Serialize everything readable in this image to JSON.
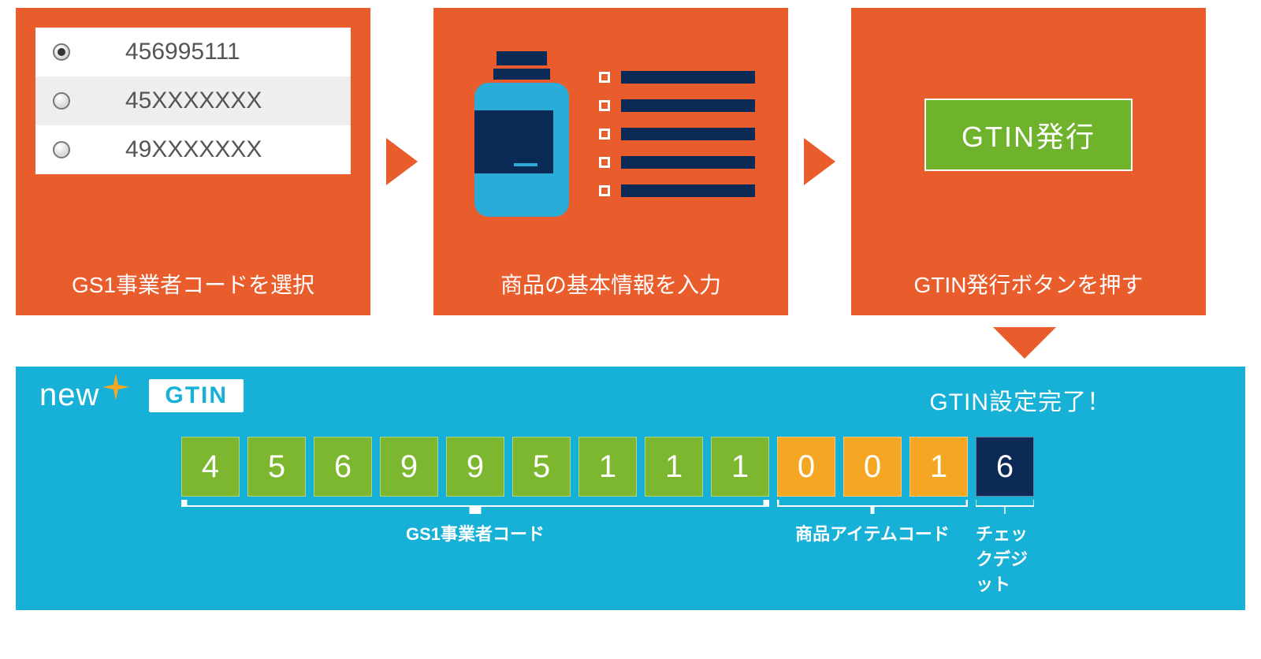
{
  "steps": {
    "step1": {
      "caption": "GS1事業者コードを選択",
      "options": [
        {
          "value": "456995111",
          "selected": true
        },
        {
          "value": "45XXXXXXX",
          "selected": false
        },
        {
          "value": "49XXXXXXX",
          "selected": false
        }
      ]
    },
    "step2": {
      "caption": "商品の基本情報を入力"
    },
    "step3": {
      "caption": "GTIN発行ボタンを押す",
      "button_label": "GTIN発行"
    }
  },
  "result": {
    "new_label": "new",
    "badge": "GTIN",
    "complete_text": "GTIN設定完了！",
    "digits": [
      {
        "d": "4",
        "group": "prefix"
      },
      {
        "d": "5",
        "group": "prefix"
      },
      {
        "d": "6",
        "group": "prefix"
      },
      {
        "d": "9",
        "group": "prefix"
      },
      {
        "d": "9",
        "group": "prefix"
      },
      {
        "d": "5",
        "group": "prefix"
      },
      {
        "d": "1",
        "group": "prefix"
      },
      {
        "d": "1",
        "group": "prefix"
      },
      {
        "d": "1",
        "group": "prefix"
      },
      {
        "d": "0",
        "group": "item"
      },
      {
        "d": "0",
        "group": "item"
      },
      {
        "d": "1",
        "group": "item"
      },
      {
        "d": "6",
        "group": "check"
      }
    ],
    "labels": {
      "prefix": "GS1事業者コード",
      "item": "商品アイテムコード",
      "check": "チェックデジット"
    }
  }
}
